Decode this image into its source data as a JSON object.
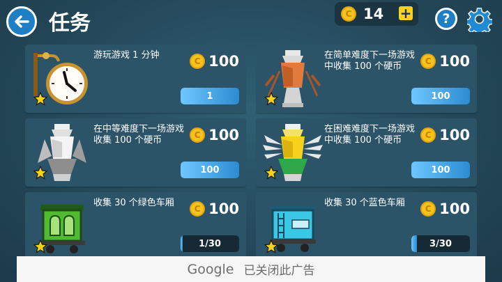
{
  "header": {
    "title": "任务",
    "coins": "14",
    "plus_label": "+",
    "help_label": "?"
  },
  "coin_symbol": "C",
  "missions": [
    {
      "description": "游玩游戏 1 分钟",
      "reward": "100",
      "progress": "1",
      "fill": 1.0,
      "icon": "clock-icon"
    },
    {
      "description": "在简单难度下一场游戏中收集 100 个硬币",
      "reward": "100",
      "progress": "100",
      "fill": 1.0,
      "icon": "bronze-trophy-icon"
    },
    {
      "description": "在中等难度下一场游戏收集 100 个硬币",
      "reward": "100",
      "progress": "100",
      "fill": 1.0,
      "icon": "silver-trophy-icon"
    },
    {
      "description": "在困难难度下一场游戏中收集 100 个硬币",
      "reward": "100",
      "progress": "100",
      "fill": 1.0,
      "icon": "gold-trophy-icon"
    },
    {
      "description": "收集 30 个绿色车厢",
      "reward": "100",
      "progress": "1/30",
      "fill": 0.033,
      "icon": "green-carriage-icon"
    },
    {
      "description": "收集 30 个蓝色车厢",
      "reward": "100",
      "progress": "3/30",
      "fill": 0.1,
      "icon": "blue-tank-car-icon"
    }
  ],
  "ad": {
    "brand": "Google",
    "text": "已关闭此广告"
  },
  "colors": {
    "accent_blue": "#1f7fc4",
    "coin_gold": "#f7c21b",
    "card_bg": "#2c5468",
    "progress_fill": "#4fb0f0"
  }
}
